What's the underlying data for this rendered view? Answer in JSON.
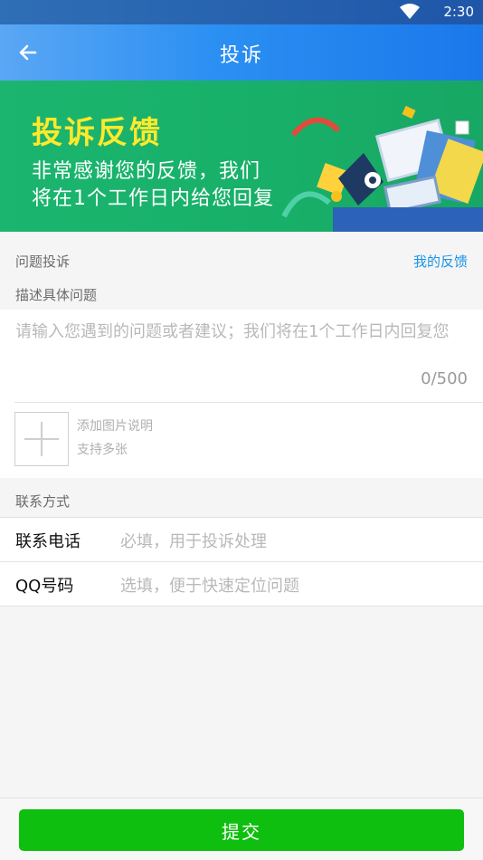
{
  "status_bar": {
    "time": "2:30"
  },
  "app_bar": {
    "title": "投诉",
    "back_icon": "arrow-left-icon"
  },
  "banner": {
    "title": "投诉反馈",
    "line1": "非常感谢您的反馈，我们",
    "line2": "将在1个工作日内给您回复"
  },
  "section_problem": {
    "label": "问题投诉",
    "link": "我的反馈"
  },
  "describe": {
    "label": "描述具体问题",
    "placeholder": "请输入您遇到的问题或者建议；我们将在1个工作日内回复您",
    "counter": "0/500",
    "add_image_hint1": "添加图片说明",
    "add_image_hint2": "支持多张"
  },
  "contact": {
    "label": "联系方式",
    "rows": [
      {
        "label": "联系电话",
        "placeholder": "必填，用于投诉处理"
      },
      {
        "label": "QQ号码",
        "placeholder": "选填，便于快速定位问题"
      }
    ]
  },
  "submit_label": "提交",
  "colors": {
    "accent_blue": "#1a93e8",
    "submit_green": "#0fbf0f",
    "banner_green": "#1bb56f",
    "banner_title": "#ffe92c"
  }
}
